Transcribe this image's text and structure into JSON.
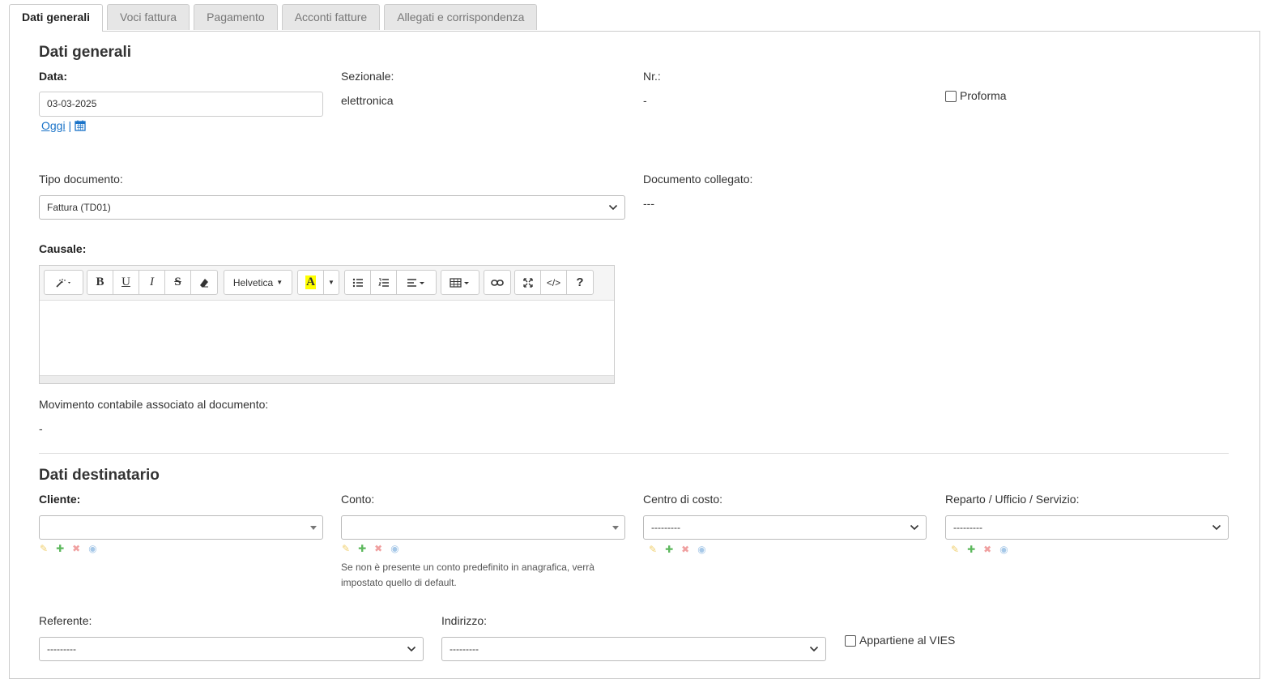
{
  "tabs": [
    {
      "label": "Dati generali",
      "active": true
    },
    {
      "label": "Voci fattura"
    },
    {
      "label": "Pagamento"
    },
    {
      "label": "Acconti fatture"
    },
    {
      "label": "Allegati e corrispondenza"
    }
  ],
  "general": {
    "title": "Dati generali",
    "data_label": "Data:",
    "data_value": "03-03-2025",
    "oggi_link": "Oggi",
    "sep": "|",
    "sezionale_label": "Sezionale:",
    "sezionale_value": "elettronica",
    "nr_label": "Nr.:",
    "nr_value": "-",
    "proforma_label": "Proforma",
    "tipo_label": "Tipo documento:",
    "tipo_value": "Fattura (TD01)",
    "collegato_label": "Documento collegato:",
    "collegato_value": "---",
    "causale_label": "Causale:",
    "movimento_label": "Movimento contabile associato al documento:",
    "movimento_value": "-"
  },
  "editor": {
    "font_name": "Helvetica",
    "bold": "B",
    "underline": "U",
    "italic": "I",
    "strike": "S",
    "text_color": "A",
    "code": "</>",
    "help": "?"
  },
  "recipient": {
    "title": "Dati destinatario",
    "cliente_label": "Cliente:",
    "cliente_value": "",
    "conto_label": "Conto:",
    "conto_value": "",
    "conto_help": "Se non è presente un conto predefinito in anagrafica, verrà impostato quello di default.",
    "centro_label": "Centro di costo:",
    "centro_value": "---------",
    "reparto_label": "Reparto / Ufficio / Servizio:",
    "reparto_value": "---------",
    "referente_label": "Referente:",
    "referente_value": "---------",
    "indirizzo_label": "Indirizzo:",
    "indirizzo_value": "---------",
    "vies_label": "Appartiene al VIES"
  },
  "colors": {
    "link": "#1a73c8",
    "add": "#5cb85c",
    "highlight": "#ffff00"
  }
}
